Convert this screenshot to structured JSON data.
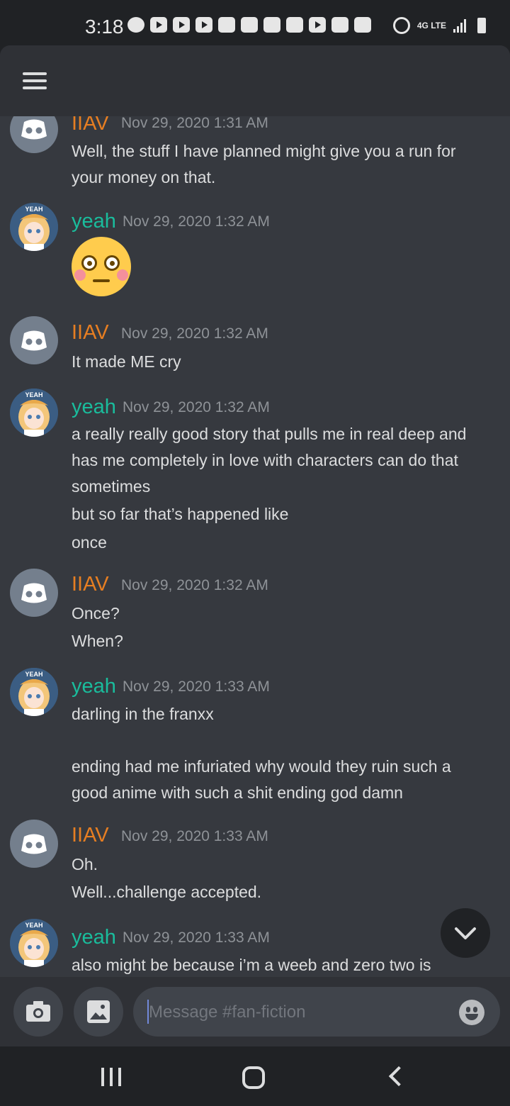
{
  "status_bar": {
    "time": "3:18",
    "network_label": "4G LTE",
    "notification_icons": [
      "messenger-icon",
      "youtube-icon",
      "youtube-icon",
      "youtube-icon",
      "discord-icon",
      "hand-icon",
      "voicemail-icon",
      "gmail-icon",
      "youtube-icon",
      "gallery-icon",
      "calendar-icon"
    ],
    "right_icons": [
      "alarm-icon",
      "signal-icon",
      "battery-icon"
    ]
  },
  "header": {
    "menu_icon": "hamburger-icon"
  },
  "users": {
    "iiav": {
      "name": "IIAV",
      "color": "#e67e22",
      "avatar": "discord-default-avatar"
    },
    "yeah": {
      "name": "yeah",
      "color": "#1abc9c",
      "avatar": "anime-avatar",
      "avatar_caption": "YEAH"
    }
  },
  "messages": [
    {
      "author": "IIAV",
      "timestamp": "Nov 29, 2020 1:31 AM",
      "lines": [
        "Well, the stuff I have planned might give you a run for",
        "your money on that."
      ]
    },
    {
      "author": "yeah",
      "timestamp": "Nov 29, 2020 1:32 AM",
      "emoji": "flushed-face"
    },
    {
      "author": "IIAV",
      "timestamp": "Nov 29, 2020 1:32 AM",
      "lines": [
        "It made ME cry"
      ]
    },
    {
      "author": "yeah",
      "timestamp": "Nov 29, 2020 1:32 AM",
      "lines": [
        "a really really good story that pulls me in real deep and",
        "has me completely in love with characters can do that",
        "sometimes",
        "but so far that’s happened like",
        "once"
      ]
    },
    {
      "author": "IIAV",
      "timestamp": "Nov 29, 2020 1:32 AM",
      "lines": [
        "Once?",
        "When?"
      ]
    },
    {
      "author": "yeah",
      "timestamp": "Nov 29, 2020 1:33 AM",
      "lines": [
        "darling in the franxx",
        "ending had me infuriated why would they ruin such a",
        "good anime with such a shit ending god damn"
      ]
    },
    {
      "author": "IIAV",
      "timestamp": "Nov 29, 2020 1:33 AM",
      "lines": [
        "Oh.",
        "Well...challenge accepted."
      ]
    },
    {
      "author": "yeah",
      "timestamp": "Nov 29, 2020 1:33 AM",
      "lines": [
        "also might be because i’m a weeb and zero two is"
      ]
    }
  ],
  "composer": {
    "placeholder": "Message #fan-fiction",
    "camera_icon": "camera-icon",
    "gallery_icon": "image-icon",
    "emoji_icon": "emoji-icon"
  },
  "scroll_button_icon": "chevron-down-icon",
  "nav_bar": [
    "recents-icon",
    "home-icon",
    "back-icon"
  ]
}
